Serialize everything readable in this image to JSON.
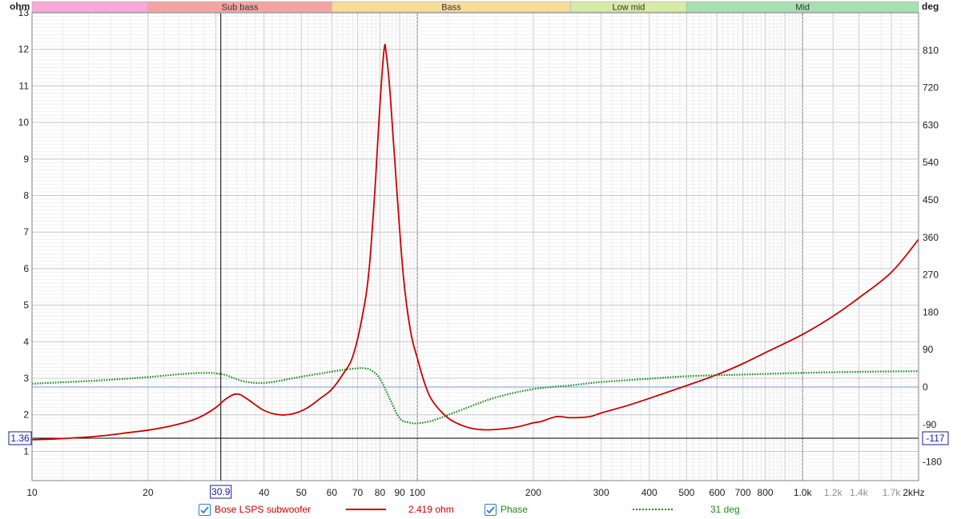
{
  "chart_data": {
    "type": "line",
    "x_scale": "log",
    "xlim": [
      10,
      2000
    ],
    "ylim_left": [
      0.2,
      13
    ],
    "ylim_right": [
      -225,
      900
    ],
    "left_unit": "ohm",
    "right_unit": "deg",
    "x_unit": "kHz",
    "x_tick_labels": [
      "10",
      "20",
      "30",
      "40",
      "50",
      "60",
      "70",
      "80",
      "90",
      "100",
      "200",
      "300",
      "400",
      "500",
      "600",
      "700",
      "800",
      "1.0k",
      "1.2k",
      "1.4k",
      "1.7k",
      "2kHz"
    ],
    "y_left_tick_labels": [
      "1",
      "2",
      "3",
      "4",
      "5",
      "6",
      "7",
      "8",
      "9",
      "10",
      "11",
      "12",
      "13"
    ],
    "y_right_tick_labels": [
      "-180",
      "-90",
      "0",
      "90",
      "180",
      "270",
      "360",
      "450",
      "540",
      "630",
      "720",
      "810"
    ],
    "bands": [
      {
        "label": "",
        "color": "#f9a8d8"
      },
      {
        "label": "Sub bass",
        "color": "#f4a3a3"
      },
      {
        "label": "Bass",
        "color": "#f7dc98"
      },
      {
        "label": "Low mid",
        "color": "#d6eba3"
      },
      {
        "label": "Mid",
        "color": "#a6e0b0"
      }
    ],
    "cursor": {
      "x_label": "30.9",
      "y_left_label": "1.36",
      "y_right_label": "-117"
    },
    "series": [
      {
        "name": "Bose LSPS subwoofer",
        "color": "#cc0000",
        "axis": "left",
        "x": [
          10,
          12,
          15,
          18,
          20,
          23,
          26,
          28,
          30,
          32,
          34,
          36,
          40,
          44,
          48,
          52,
          56,
          60,
          64,
          68,
          72,
          75,
          78,
          80,
          82,
          83,
          85,
          88,
          92,
          96,
          100,
          105,
          110,
          120,
          130,
          140,
          150,
          160,
          180,
          200,
          210,
          230,
          250,
          280,
          300,
          350,
          400,
          500,
          600,
          700,
          800,
          1000,
          1200,
          1400,
          1700,
          2000
        ],
        "y": [
          1.32,
          1.35,
          1.42,
          1.52,
          1.58,
          1.7,
          1.85,
          2.0,
          2.2,
          2.45,
          2.57,
          2.45,
          2.12,
          2.0,
          2.04,
          2.2,
          2.45,
          2.7,
          3.1,
          3.6,
          4.7,
          6.0,
          8.5,
          10.5,
          12.0,
          11.9,
          10.8,
          8.5,
          5.8,
          4.3,
          3.55,
          2.8,
          2.35,
          1.92,
          1.72,
          1.62,
          1.59,
          1.6,
          1.66,
          1.78,
          1.82,
          1.95,
          1.92,
          1.95,
          2.05,
          2.25,
          2.45,
          2.8,
          3.1,
          3.4,
          3.7,
          4.2,
          4.7,
          5.2,
          5.9,
          6.8
        ]
      },
      {
        "name": "Phase",
        "color": "#1a8c1a",
        "axis": "right",
        "x": [
          10,
          15,
          20,
          25,
          28,
          30,
          32,
          35,
          38,
          42,
          50,
          60,
          65,
          70,
          73,
          76,
          80,
          85,
          90,
          95,
          100,
          110,
          130,
          160,
          200,
          250,
          300,
          400,
          500,
          700,
          1000,
          1500,
          2000
        ],
        "y": [
          8,
          16,
          24,
          32,
          34,
          33,
          28,
          15,
          10,
          12,
          25,
          37,
          42,
          45,
          45,
          40,
          20,
          -30,
          -75,
          -85,
          -87,
          -80,
          -55,
          -25,
          -5,
          4,
          12,
          20,
          26,
          30,
          34,
          37,
          38
        ]
      }
    ],
    "readouts": {
      "impedance": "2.419 ohm",
      "phase": "31 deg"
    }
  }
}
